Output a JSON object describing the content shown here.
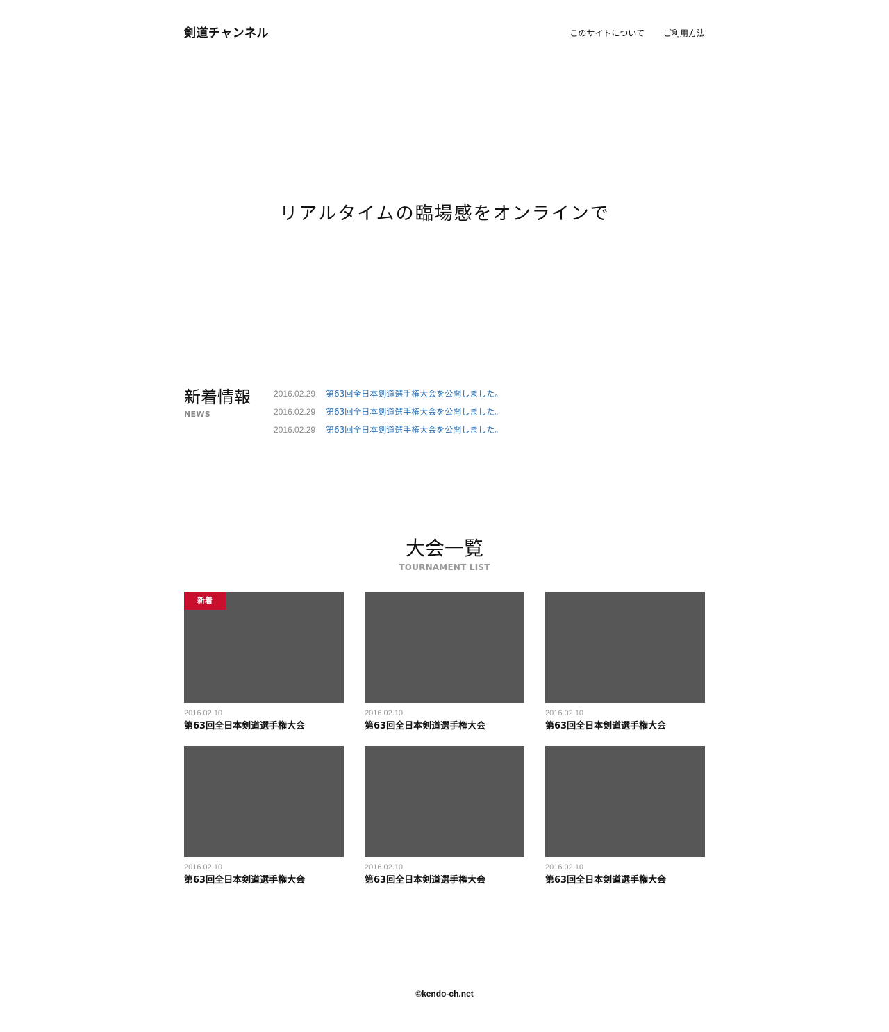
{
  "header": {
    "logo": "剣道チャンネル",
    "nav": [
      {
        "label": "このサイトについて"
      },
      {
        "label": "ご利用方法"
      }
    ]
  },
  "hero": {
    "title": "リアルタイムの臨場感をオンラインで"
  },
  "news": {
    "title": "新着情報",
    "subtitle": "NEWS",
    "items": [
      {
        "date": "2016.02.29",
        "text": "第63回全日本剣道選手権大会を公開しました。"
      },
      {
        "date": "2016.02.29",
        "text": "第63回全日本剣道選手権大会を公開しました。"
      },
      {
        "date": "2016.02.29",
        "text": "第63回全日本剣道選手権大会を公開しました。"
      }
    ]
  },
  "tournaments": {
    "title": "大会一覧",
    "subtitle": "TOURNAMENT LIST",
    "badge_label": "新着",
    "thumb_color": "#575757",
    "badge_color": "#c8102e",
    "cards": [
      {
        "date": "2016.02.10",
        "title": "第63回全日本剣道選手権大会",
        "is_new": true
      },
      {
        "date": "2016.02.10",
        "title": "第63回全日本剣道選手権大会",
        "is_new": false
      },
      {
        "date": "2016.02.10",
        "title": "第63回全日本剣道選手権大会",
        "is_new": false
      },
      {
        "date": "2016.02.10",
        "title": "第63回全日本剣道選手権大会",
        "is_new": false
      },
      {
        "date": "2016.02.10",
        "title": "第63回全日本剣道選手権大会",
        "is_new": false
      },
      {
        "date": "2016.02.10",
        "title": "第63回全日本剣道選手権大会",
        "is_new": false
      }
    ]
  },
  "footer": {
    "copyright": "©kendo-ch.net"
  },
  "colors": {
    "link": "#2a6eb0",
    "muted": "#888888"
  }
}
